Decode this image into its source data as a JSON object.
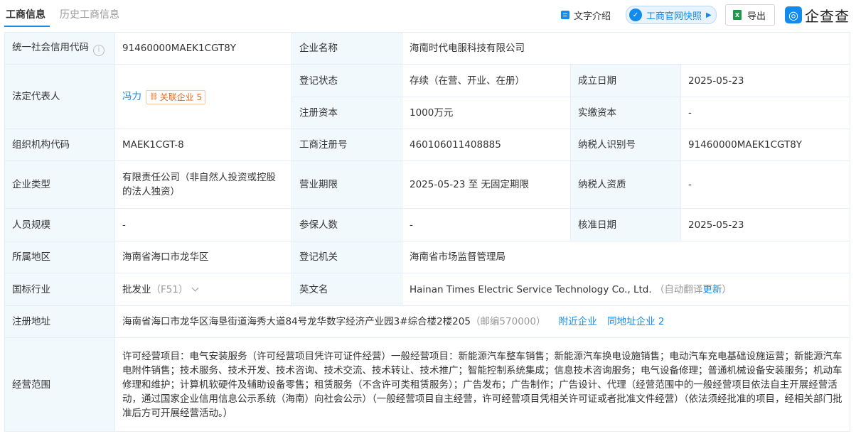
{
  "tabs": {
    "active": "工商信息",
    "history": "历史工商信息"
  },
  "toolbar": {
    "text_intro": "文字介绍",
    "snapshot": "工商官网快照",
    "export": "导出",
    "logo_text": "企查查"
  },
  "colors": {
    "accent": "#128bed",
    "label_bg": "#f2f9fc",
    "border": "#e4eef6",
    "badge_orange": "#e66a1a",
    "excel_green": "#1e9a4e"
  },
  "icons": [
    "document-icon",
    "snapshot-icon",
    "chevron-right-icon",
    "excel-icon",
    "qcc-logo-icon",
    "question-icon",
    "related-company-icon",
    "chevron-down-icon"
  ],
  "labels": {
    "credit_code": "统一社会信用代码",
    "company_name": "企业名称",
    "legal_rep": "法定代表人",
    "reg_status": "登记状态",
    "established": "成立日期",
    "reg_capital": "注册资本",
    "paid_capital": "实缴资本",
    "org_code": "组织机构代码",
    "reg_no": "工商注册号",
    "taxpayer_id": "纳税人识别号",
    "company_type": "企业类型",
    "business_term": "营业期限",
    "taxpayer_qual": "纳税人资质",
    "staff_size": "人员规模",
    "insured": "参保人数",
    "approval_date": "核准日期",
    "region": "所属地区",
    "reg_authority": "登记机关",
    "industry": "国标行业",
    "english_name": "英文名",
    "reg_address": "注册地址",
    "business_scope": "经营范围"
  },
  "values": {
    "credit_code": "91460000MAEK1CGT8Y",
    "company_name": "海南时代电服科技有限公司",
    "legal_rep": "冯力",
    "related_label": "关联企业",
    "related_count": "5",
    "reg_status": "存续（在营、开业、在册）",
    "established": "2025-05-23",
    "reg_capital": "1000万元",
    "paid_capital": "-",
    "org_code": "MAEK1CGT-8",
    "reg_no": "460106011408885",
    "taxpayer_id": "91460000MAEK1CGT8Y",
    "company_type": "有限责任公司（非自然人投资或控股的法人独资）",
    "business_term": "2025-05-23 至 无固定期限",
    "taxpayer_qual": "-",
    "staff_size": "-",
    "insured": "-",
    "approval_date": "2025-05-23",
    "region": "海南省海口市龙华区",
    "reg_authority": "海南省市场监督管理局",
    "industry": "批发业",
    "industry_code": "（F51）",
    "english_name": "Hainan Times Electric Service Technology Co., Ltd.",
    "auto_translate": "（自动翻译",
    "update_link": "更新",
    "auto_translate_close": "）",
    "reg_address": "海南省海口市龙华区海垦街道海秀大道84号龙华数字经济产业园3#综合楼2楼205",
    "postcode": "（邮编570000）",
    "nearby": "附近企业",
    "same_address": "同地址企业 2",
    "business_scope": "许可经营项目：电气安装服务（许可经营项目凭许可证件经营）一般经营项目：新能源汽车整车销售；新能源汽车换电设施销售；电动汽车充电基础设施运营；新能源汽车电附件销售；技术服务、技术开发、技术咨询、技术交流、技术转让、技术推广；智能控制系统集成；信息技术咨询服务；电气设备修理；普通机械设备安装服务；机动车修理和维护；计算机软硬件及辅助设备零售；租赁服务（不含许可类租赁服务）；广告发布；广告制作；广告设计、代理（经营范围中的一般经营项目依法自主开展经营活动，通过国家企业信用信息公示系统（海南）向社会公示）（一般经营项目自主经营，许可经营项目凭相关许可证或者批准文件经营）（依法须经批准的项目，经相关部门批准后方可开展经营活动。）"
  }
}
